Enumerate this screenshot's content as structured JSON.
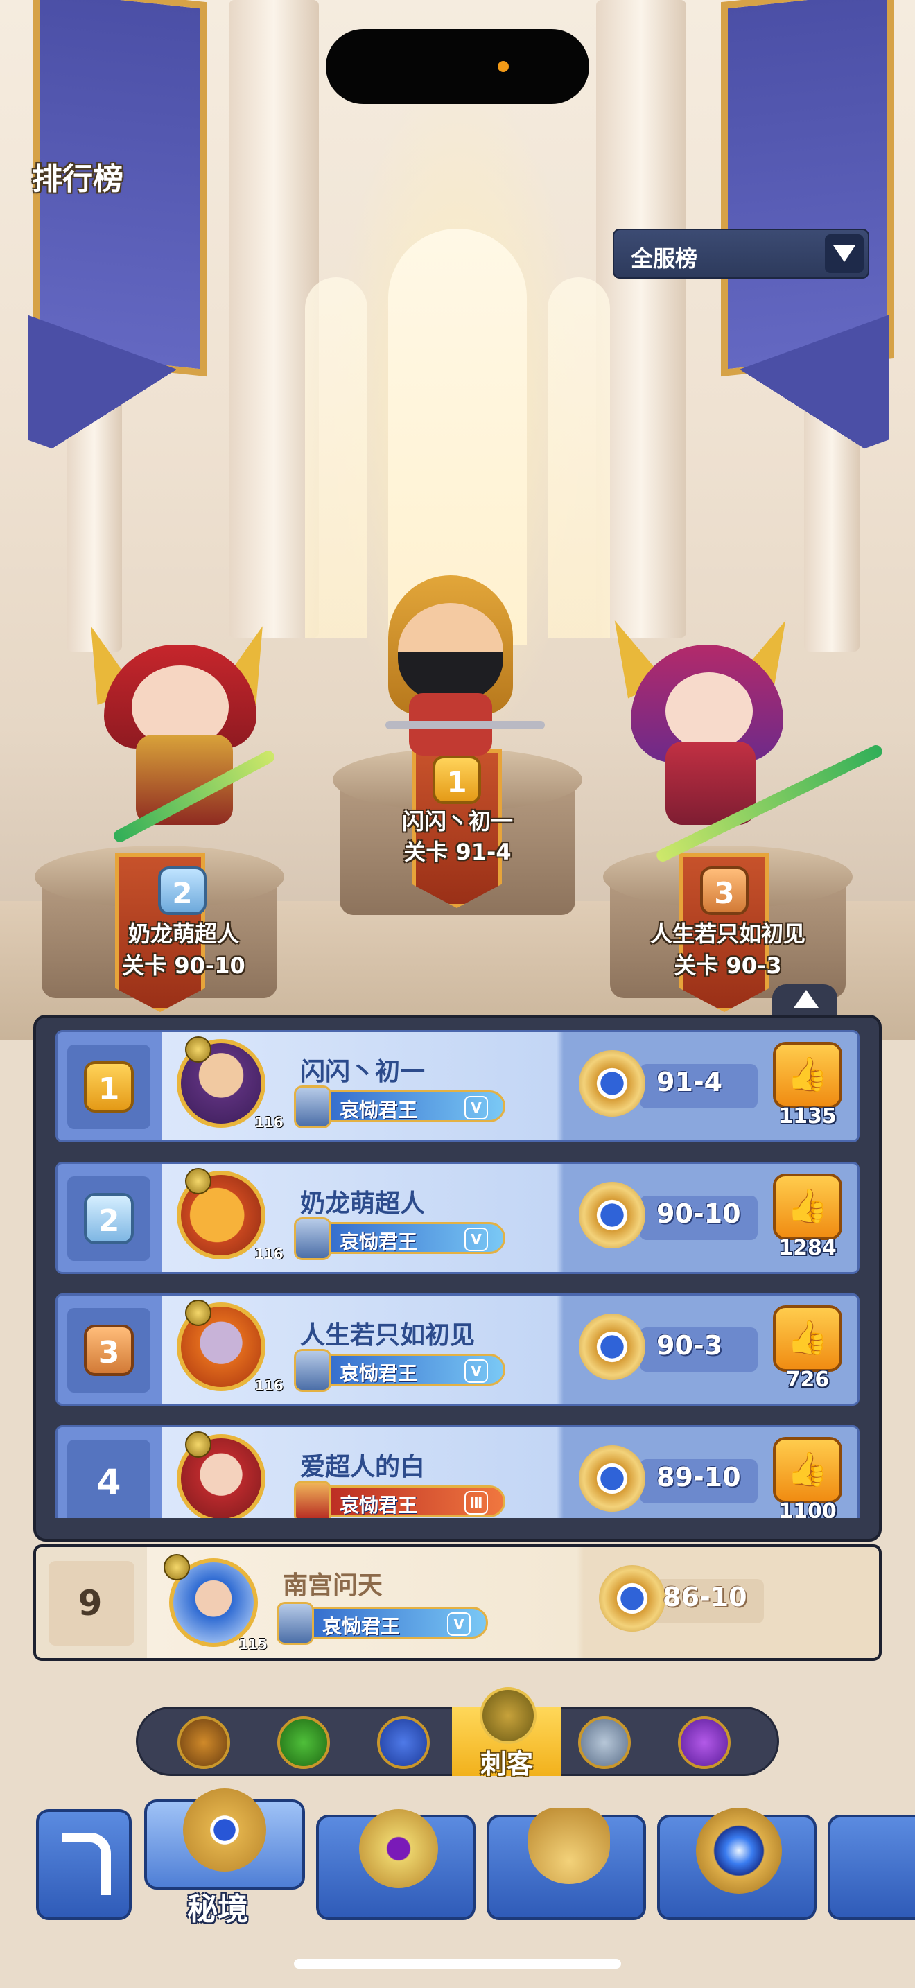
{
  "screen": {
    "title": "排行榜"
  },
  "server_select": {
    "label": "全服榜"
  },
  "podium": [
    {
      "rank": "1",
      "name": "闪闪丶初一",
      "stage": "关卡 91-4"
    },
    {
      "rank": "2",
      "name": "奶龙萌超人",
      "stage": "关卡 90-10"
    },
    {
      "rank": "3",
      "name": "人生若只如初见",
      "stage": "关卡 90-3"
    }
  ],
  "ranking": [
    {
      "rank": "1",
      "name": "闪闪丶初一",
      "level": "116",
      "title": "哀恸君王",
      "tier": "V",
      "stage": "91-4",
      "likes": "1135"
    },
    {
      "rank": "2",
      "name": "奶龙萌超人",
      "level": "116",
      "title": "哀恸君王",
      "tier": "V",
      "stage": "90-10",
      "likes": "1284"
    },
    {
      "rank": "3",
      "name": "人生若只如初见",
      "level": "116",
      "title": "哀恸君王",
      "tier": "V",
      "stage": "90-3",
      "likes": "726"
    },
    {
      "rank": "4",
      "name": "爱超人的白",
      "level": "",
      "title": "哀恸君王",
      "tier": "Ⅲ",
      "stage": "89-10",
      "likes": "1100"
    }
  ],
  "my_rank": {
    "rank": "9",
    "name": "南宫问天",
    "level": "115",
    "title": "哀恸君王",
    "tier": "V",
    "stage": "86-10"
  },
  "class_tabs": {
    "items": [
      "warrior-axe",
      "archer-bow",
      "mage-staff",
      "assassin-blade",
      "priest-cross",
      "summoner-spirit"
    ],
    "active_label": "刺客"
  },
  "bottom_nav": {
    "active_label": "秘境"
  },
  "colors": {
    "accent_gold": "#e9b53b",
    "panel": "#343a4f",
    "row_blue": "#dbe7fb",
    "like_orange": "#f08c12"
  }
}
